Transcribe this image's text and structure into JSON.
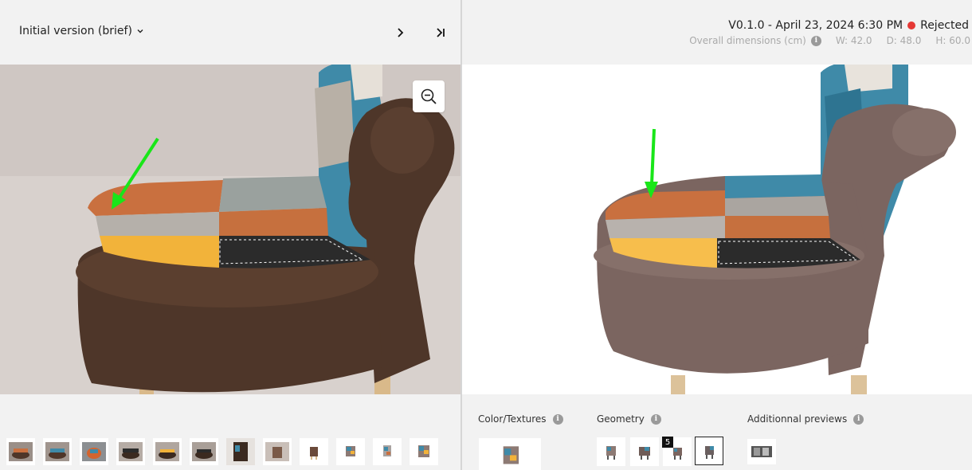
{
  "left_panel": {
    "version_select_label": "Initial version (brief)",
    "thumbnails_count": 12
  },
  "right_panel": {
    "version_label": "V0.1.0 - April 23, 2024 6:30 PM",
    "status": "Rejected",
    "status_color": "#e53935",
    "dimensions_label": "Overall dimensions (cm)",
    "width": "W: 42.0",
    "depth": "D: 48.0",
    "height": "H: 60.0",
    "sections": {
      "color_textures": "Color/Textures",
      "geometry": "Geometry",
      "additional_previews": "Additionnal previews"
    },
    "geometry_badge": "5"
  },
  "icons": {
    "chevron": "chevron-down-icon",
    "next": "chevron-right-icon",
    "last": "skip-to-end-icon",
    "zoom": "zoom-out-icon",
    "info": "info-icon"
  },
  "colors": {
    "annotation_arrow": "#19e619",
    "chair_brown": "#4e3629",
    "chair_brown_render": "#7b6560"
  }
}
